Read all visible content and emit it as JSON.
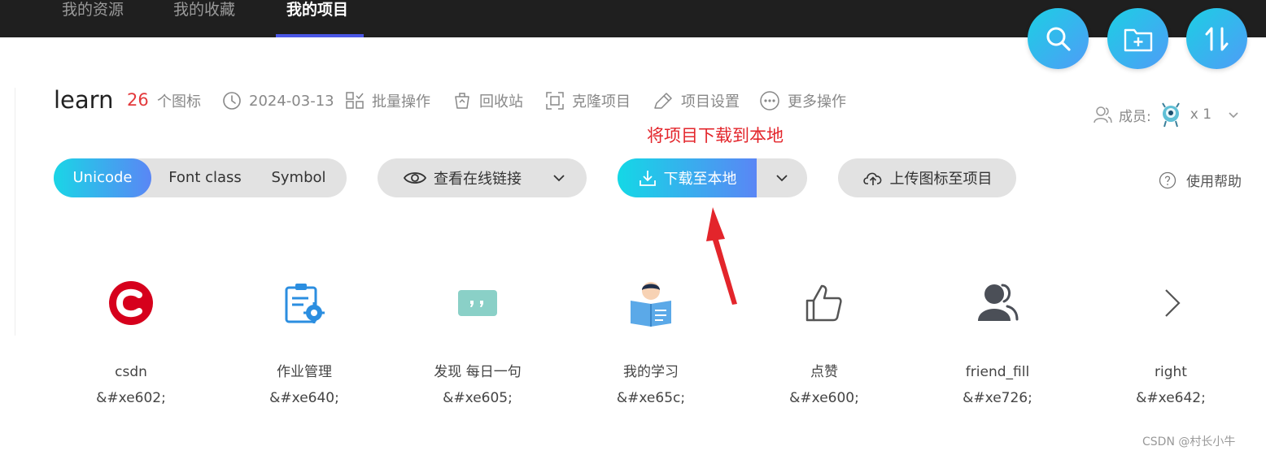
{
  "nav": {
    "tabs": [
      {
        "label": "我的资源",
        "active": false
      },
      {
        "label": "我的收藏",
        "active": false
      },
      {
        "label": "我的项目",
        "active": true
      }
    ]
  },
  "fab": [
    {
      "icon": "search-icon"
    },
    {
      "icon": "new-folder-icon"
    },
    {
      "icon": "sort-icon"
    }
  ],
  "project": {
    "name": "learn",
    "icon_count": "26",
    "count_unit": "个图标",
    "date": "2024-03-13",
    "actions": [
      {
        "label": "批量操作",
        "icon": "batch-icon"
      },
      {
        "label": "回收站",
        "icon": "recycle-bin-icon"
      },
      {
        "label": "克隆项目",
        "icon": "clone-icon"
      },
      {
        "label": "项目设置",
        "icon": "settings-pen-icon"
      },
      {
        "label": "更多操作",
        "icon": "more-icon"
      }
    ],
    "members_label": "成员:",
    "members_count": "x 1"
  },
  "annotation": "将项目下载到本地",
  "toolbar": {
    "formats": [
      "Unicode",
      "Font class",
      "Symbol"
    ],
    "active_format": "Unicode",
    "online_link": "查看在线链接",
    "download": "下载至本地",
    "upload": "上传图标至项目",
    "help": "使用帮助"
  },
  "icons": [
    {
      "name": "csdn",
      "code": "&#xe602;",
      "icon": "csdn-logo-icon"
    },
    {
      "name": "作业管理",
      "code": "&#xe640;",
      "icon": "homework-icon"
    },
    {
      "name": "发现 每日一句",
      "code": "&#xe605;",
      "icon": "quote-icon"
    },
    {
      "name": "我的学习",
      "code": "&#xe65c;",
      "icon": "study-icon"
    },
    {
      "name": "点赞",
      "code": "&#xe600;",
      "icon": "thumbs-up-icon"
    },
    {
      "name": "friend_fill",
      "code": "&#xe726;",
      "icon": "friend-icon"
    },
    {
      "name": "right",
      "code": "&#xe642;",
      "icon": "chevron-right-icon"
    }
  ],
  "watermark": "CSDN @村长小牛",
  "colors": {
    "accent_gradient_start": "#1ad5e6",
    "accent_gradient_end": "#5a86f5",
    "count_red": "#e3393c",
    "annotation_red": "#e3252b",
    "nav_bg": "#1f1f1f",
    "nav_underline": "#4a56e6"
  }
}
